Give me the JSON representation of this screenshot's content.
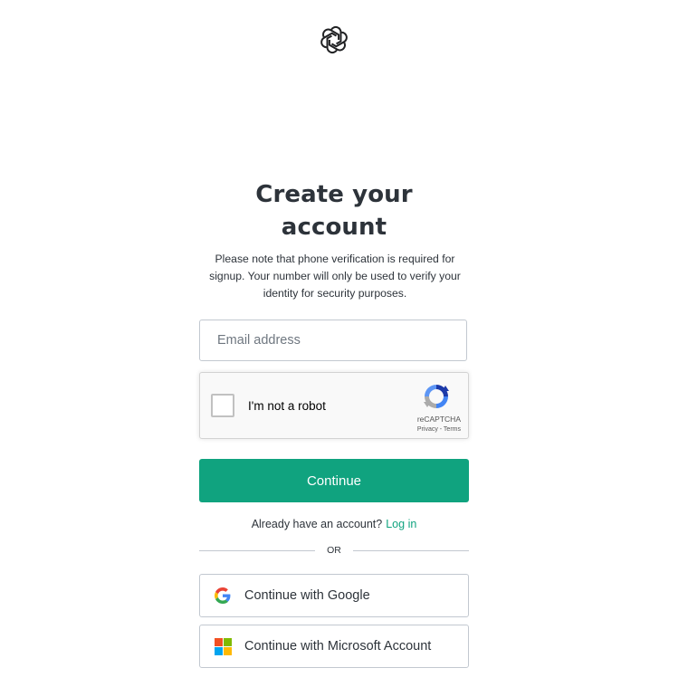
{
  "brand": {
    "logo_icon": "openai-logo-icon"
  },
  "heading": {
    "title": "Create your account",
    "subtitle": "Please note that phone verification is required for signup. Your number will only be used to verify your identity for security purposes."
  },
  "form": {
    "email_placeholder": "Email address",
    "email_value": "",
    "captcha": {
      "label": "I'm not a robot",
      "brand": "reCAPTCHA",
      "links": "Privacy - Terms",
      "checked": false
    },
    "continue_label": "Continue"
  },
  "login": {
    "prompt": "Already have an account?",
    "link_label": "Log in"
  },
  "divider": {
    "label": "OR"
  },
  "social": {
    "google_label": "Continue with Google",
    "microsoft_label": "Continue with Microsoft Account"
  },
  "colors": {
    "accent": "#10a37f",
    "text": "#2d333a",
    "border": "#c2c8d0"
  }
}
